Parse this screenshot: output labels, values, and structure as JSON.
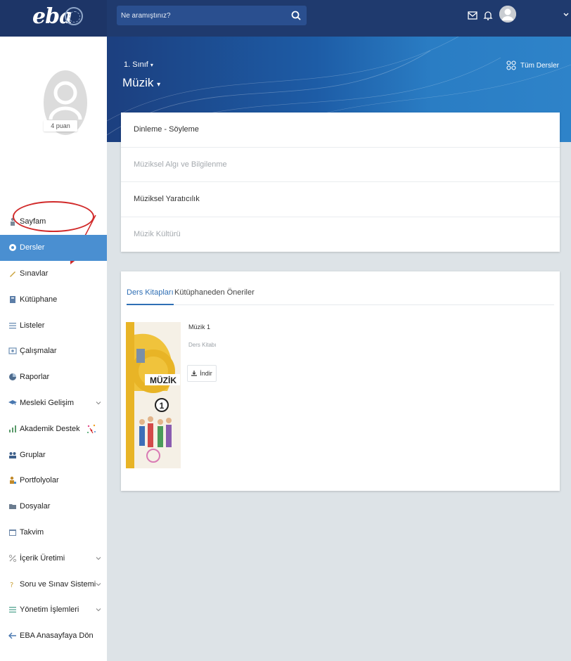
{
  "header": {
    "logo": "eba",
    "search_placeholder": "Ne aramıştınız?"
  },
  "sidebar": {
    "points": "4 puan",
    "items": [
      {
        "label": "Sayfam",
        "icon": "person-icon"
      },
      {
        "label": "Dersler",
        "icon": "book-circle-icon",
        "active": true
      },
      {
        "label": "Sınavlar",
        "icon": "pencil-icon"
      },
      {
        "label": "Kütüphane",
        "icon": "library-icon"
      },
      {
        "label": "Listeler",
        "icon": "list-icon"
      },
      {
        "label": "Çalışmalar",
        "icon": "study-icon"
      },
      {
        "label": "Raporlar",
        "icon": "report-icon"
      },
      {
        "label": "Mesleki Gelişim",
        "icon": "graduation-icon",
        "expandable": true
      },
      {
        "label": "Akademik Destek",
        "icon": "chart-icon"
      },
      {
        "label": "Gruplar",
        "icon": "group-icon"
      },
      {
        "label": "Portfolyolar",
        "icon": "portfolio-icon"
      },
      {
        "label": "Dosyalar",
        "icon": "folder-icon"
      },
      {
        "label": "Takvim",
        "icon": "calendar-icon"
      },
      {
        "label": "İçerik Üretimi",
        "icon": "content-icon",
        "expandable": true
      },
      {
        "label": "Soru ve Sınav Sistemi",
        "icon": "question-icon",
        "expandable": true
      },
      {
        "label": "Yönetim İşlemleri",
        "icon": "settings-list-icon",
        "expandable": true
      },
      {
        "label": "EBA Anasayfaya Dön",
        "icon": "back-icon"
      }
    ]
  },
  "banner": {
    "grade": "1. Sınıf",
    "subject": "Müzik",
    "all_courses": "Tüm Dersler"
  },
  "topics": [
    {
      "label": "Dinleme - Söyleme",
      "dim": false
    },
    {
      "label": "Müziksel Algı ve Bilgilenme",
      "dim": true
    },
    {
      "label": "Müziksel Yaratıcılık",
      "dim": false
    },
    {
      "label": "Müzik Kültürü",
      "dim": true
    }
  ],
  "books": {
    "tabs": [
      "Ders Kitapları",
      "Kütüphaneden Öneriler"
    ],
    "title": "Müzik 1",
    "type": "Ders Kitabı",
    "download": "İndir",
    "cover_title": "MÜZİK",
    "cover_number": "1"
  },
  "colors": {
    "topbar": "#1f3a6e",
    "active_nav": "#4a8fd1",
    "accent": "#2f6fb5",
    "annotation": "#d12a2a"
  }
}
